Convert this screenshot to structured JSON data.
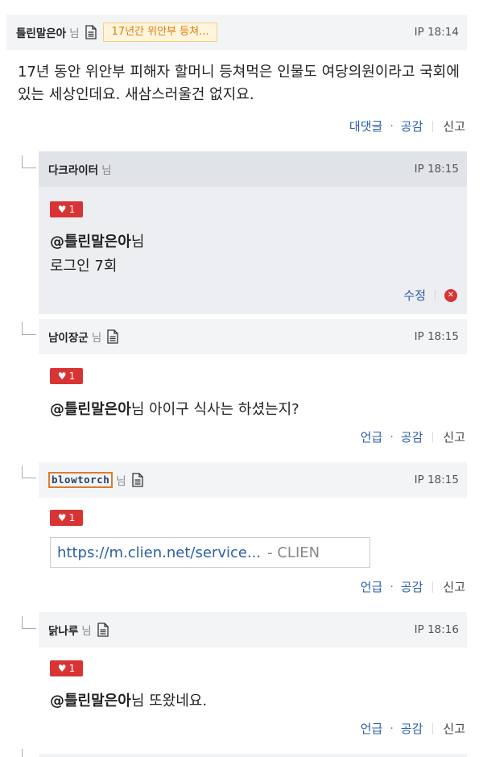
{
  "main_comment": {
    "author": "틀린말은아",
    "nim": "님",
    "tag": "17년간 위안부 등쳐...",
    "ip_time": "IP 18:14",
    "text": "17년 동안 위안부 피해자 할머니 등쳐먹은 인물도 여당의원이라고 국회에 있는 세상인데요. 새삼스러울건 없지요.",
    "actions": {
      "reply": "대댓글",
      "like": "공감",
      "report": "신고"
    }
  },
  "replies": [
    {
      "author": "다크라이터",
      "nim": "님",
      "ip_time": "IP 18:15",
      "likes": "1",
      "mention": "@틀린말은아",
      "mention_suffix": "님",
      "text": "로그인 7회",
      "actions": {
        "edit": "수정"
      }
    },
    {
      "author": "남이장군",
      "nim": "님",
      "ip_time": "IP 18:15",
      "likes": "1",
      "mention": "@틀린말은아",
      "mention_suffix": "님 아이구 식사는 하셨는지?",
      "actions": {
        "mention": "언급",
        "like": "공감",
        "report": "신고"
      }
    },
    {
      "author": "blowtorch",
      "nim": "님",
      "ip_time": "IP 18:15",
      "likes": "1",
      "link_url": "https://m.clien.net/service...",
      "link_site": "- CLIEN",
      "actions": {
        "mention": "언급",
        "like": "공감",
        "report": "신고"
      }
    },
    {
      "author": "닭나루",
      "nim": "님",
      "ip_time": "IP 18:16",
      "likes": "1",
      "mention": "@틀린말은아",
      "mention_suffix": "님 또왔네요.",
      "actions": {
        "mention": "언급",
        "like": "공감",
        "report": "신고"
      }
    }
  ],
  "icons": {
    "document": "document-icon",
    "heart": "heart-icon",
    "delete": "close-circle-icon"
  },
  "colors": {
    "accent": "#2b5fa8",
    "heart": "#d83434",
    "tag_text": "#e07a0e"
  }
}
